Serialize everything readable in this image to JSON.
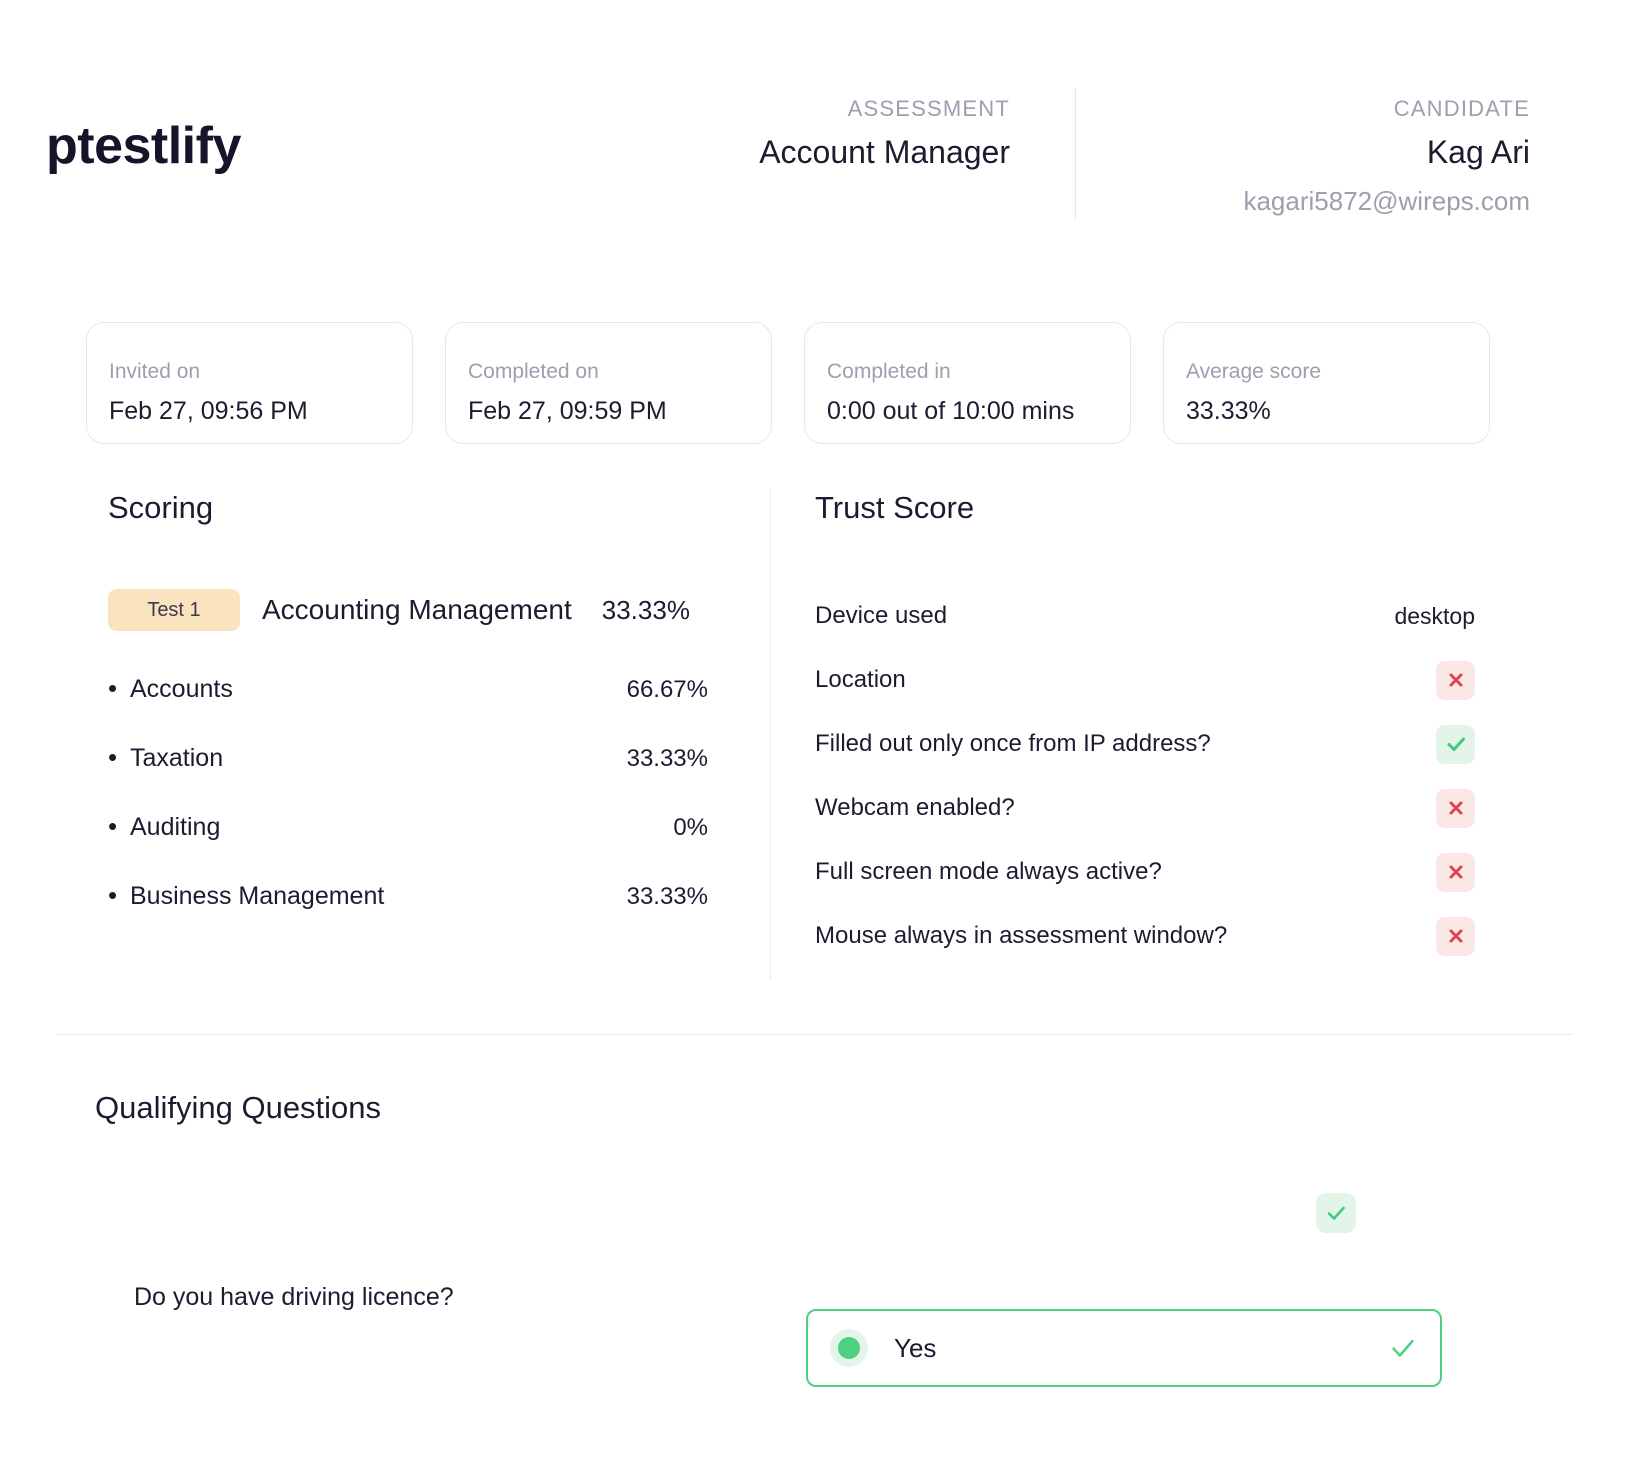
{
  "brand": {
    "name": "ptestlify"
  },
  "header": {
    "assessment": {
      "kicker": "ASSESSMENT",
      "title": "Account Manager"
    },
    "candidate": {
      "kicker": "CANDIDATE",
      "name": "Kag Ari",
      "email": "kagari5872@wireps.com"
    }
  },
  "stats": [
    {
      "label": "Invited on",
      "value": "Feb 27, 09:56 PM"
    },
    {
      "label": "Completed on",
      "value": "Feb 27, 09:59 PM"
    },
    {
      "label": "Completed in",
      "value": "0:00 out of 10:00 mins"
    },
    {
      "label": "Average score",
      "value": "33.33%"
    }
  ],
  "scoring": {
    "title": "Scoring",
    "test": {
      "badge": "Test 1",
      "name": "Accounting Management",
      "score": "33.33%"
    },
    "items": [
      {
        "name": "Accounts",
        "score": "66.67%"
      },
      {
        "name": "Taxation",
        "score": "33.33%"
      },
      {
        "name": "Auditing",
        "score": "0%"
      },
      {
        "name": "Business Management",
        "score": "33.33%"
      }
    ]
  },
  "trust": {
    "title": "Trust Score",
    "rows": [
      {
        "label": "Device used",
        "type": "text",
        "value": "desktop",
        "icon": ""
      },
      {
        "label": "Location",
        "type": "status",
        "value": "no",
        "icon": "cross-icon"
      },
      {
        "label": "Filled out only once from IP address?",
        "type": "status",
        "value": "yes",
        "icon": "check-icon"
      },
      {
        "label": "Webcam enabled?",
        "type": "status",
        "value": "no",
        "icon": "cross-icon"
      },
      {
        "label": "Full screen mode always active?",
        "type": "status",
        "value": "no",
        "icon": "cross-icon"
      },
      {
        "label": "Mouse always in assessment window?",
        "type": "status",
        "value": "no",
        "icon": "cross-icon"
      }
    ]
  },
  "qualifying": {
    "title": "Qualifying Questions",
    "status_icon": "check-icon",
    "question": "Do you have driving licence?",
    "answer": "Yes",
    "answer_icon": "check-icon"
  },
  "colors": {
    "accent_green": "#4dd07f",
    "negative_red": "#dc4b4b",
    "badge_peach": "#fbe3c0",
    "text_dark": "#1d1b30",
    "text_muted": "#9ca0ae"
  }
}
